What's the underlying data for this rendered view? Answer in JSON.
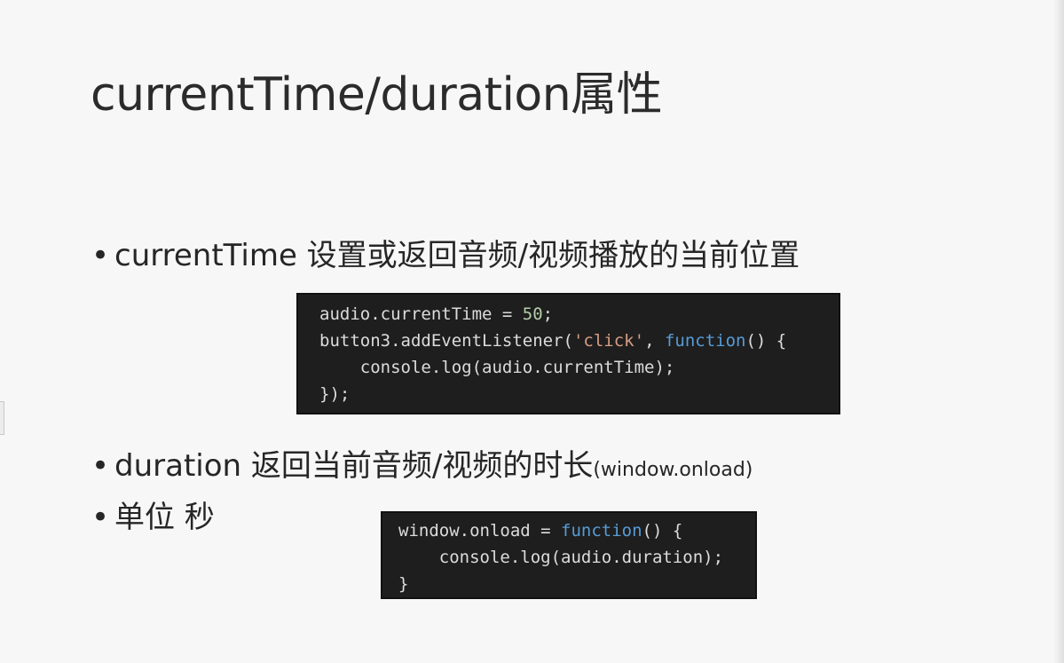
{
  "slide": {
    "title": "currentTime/duration属性",
    "bullets": [
      {
        "text": "currentTime 设置或返回音频/视频播放的当前位置"
      },
      {
        "text": "duration 返回当前音频/视频的时长",
        "small": "(window.onload)"
      },
      {
        "text": "单位 秒"
      }
    ],
    "code_blocks": [
      {
        "lines": [
          [
            {
              "t": "audio.currentTime = "
            },
            {
              "t": "50",
              "c": "num"
            },
            {
              "t": ";"
            }
          ],
          [
            {
              "t": "button3.addEventListener("
            },
            {
              "t": "'click'",
              "c": "str"
            },
            {
              "t": ", "
            },
            {
              "t": "function",
              "c": "kw"
            },
            {
              "t": "() {"
            }
          ],
          [
            {
              "t": "    console.log(audio.currentTime);"
            }
          ],
          [
            {
              "t": "});"
            }
          ]
        ]
      },
      {
        "lines": [
          [
            {
              "t": "window.onload = "
            },
            {
              "t": "function",
              "c": "kw"
            },
            {
              "t": "() {"
            }
          ],
          [
            {
              "t": "    console.log(audio.duration);"
            }
          ],
          [
            {
              "t": "}"
            }
          ]
        ]
      }
    ]
  }
}
